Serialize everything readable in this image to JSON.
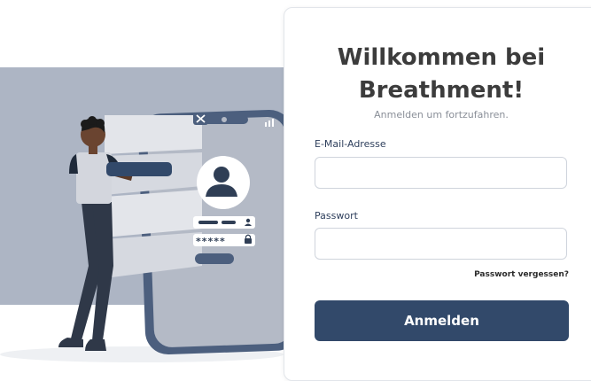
{
  "login": {
    "title_line1": "Willkommen bei",
    "title_line2": "Breathment!",
    "subtitle": "Anmelden um fortzufahren.",
    "email_label": "E-Mail-Adresse",
    "email_value": "",
    "email_placeholder": "",
    "password_label": "Passwort",
    "password_value": "",
    "password_placeholder": "",
    "forgot_link": "Passwort vergessen?",
    "submit_label": "Anmelden"
  },
  "illustration": {
    "password_mask": "*****",
    "icons": [
      "close-icon",
      "user-avatar-icon",
      "user-icon",
      "lock-icon",
      "signal-icon"
    ]
  },
  "colors": {
    "primary": "#32496a",
    "backdrop": "#adb5c4",
    "phone": "#4c5f7e",
    "title": "#3c3c3c"
  }
}
